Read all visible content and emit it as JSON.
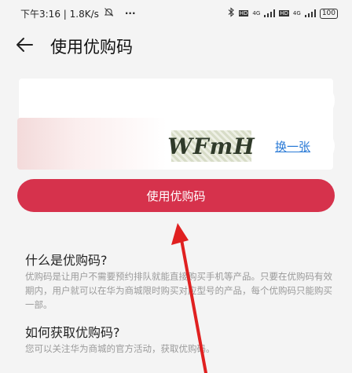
{
  "status_bar": {
    "time_speed": "下午3:16 | 1.8K/s",
    "dots": "···",
    "hd1": "HD",
    "net1": "4G",
    "hd2": "HD",
    "net2": "4G",
    "battery": "100"
  },
  "header": {
    "title": "使用优购码"
  },
  "form": {
    "code_value": "",
    "captcha_text": "WFmH",
    "refresh_label": "换一张",
    "submit_label": "使用优购码"
  },
  "sections": {
    "what_title": "什么是优购码?",
    "what_body": "优购码是让用户不需要预约排队就能直接购买手机等产品。只要在优购码有效期内，用户就可以在华为商城限时购买对应型号的产品，每个优购码只能购买一部。",
    "how_title": "如何获取优购码?",
    "how_body": "您可以关注华为商城的官方活动，获取优购码。"
  },
  "colors": {
    "accent": "#d6324c",
    "link": "#2a7ad6",
    "annotation_arrow": "#e02020"
  }
}
